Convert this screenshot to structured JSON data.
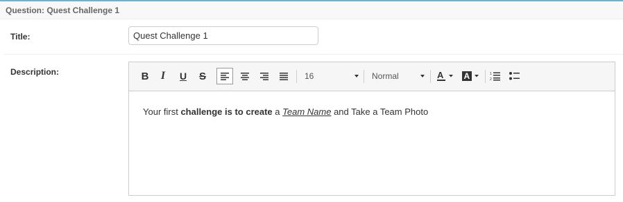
{
  "header": {
    "title": "Question: Quest Challenge 1"
  },
  "form": {
    "title_label": "Title:",
    "title_value": "Quest Challenge 1",
    "description_label": "Description:"
  },
  "toolbar": {
    "bold": "B",
    "italic": "I",
    "underline": "U",
    "strike": "S",
    "font_size": "16",
    "block_format": "Normal",
    "icons": [
      "bold-icon",
      "italic-icon",
      "underline-icon",
      "strikethrough-icon",
      "align-left-icon",
      "align-center-icon",
      "align-right-icon",
      "align-justify-icon",
      "text-color-icon",
      "background-color-icon",
      "ordered-list-icon",
      "unordered-list-icon"
    ]
  },
  "editor": {
    "seg1": "Your first ",
    "seg2": "challenge is to create",
    "seg3": " a ",
    "seg4": "Team Name",
    "seg5": " and Take a Team Photo"
  }
}
